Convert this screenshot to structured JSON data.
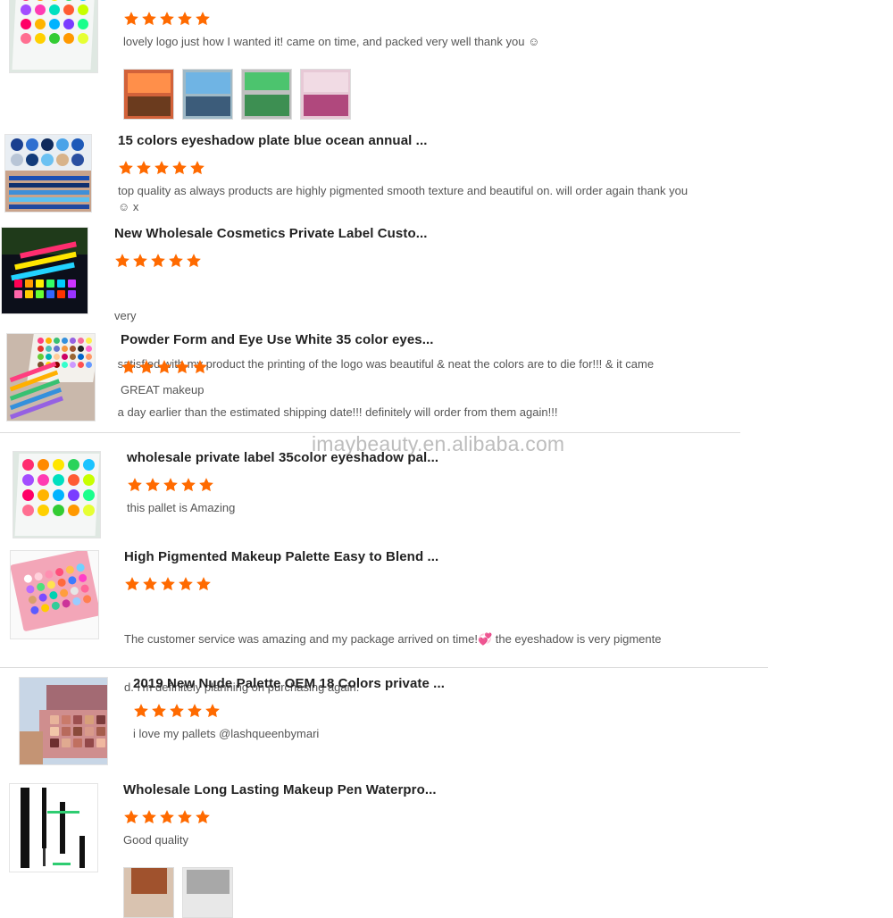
{
  "colors": {
    "star": "#ff6a00",
    "divider": "#dcdcdc"
  },
  "reviews": [
    {
      "title": "",
      "rating": 5,
      "text": "lovely logo just how I wanted it! came on time, and packed very well thank you ☺"
    },
    {
      "title": "15 colors eyeshadow plate blue ocean annual ...",
      "rating": 5,
      "text": "top quality as always products are highly pigmented smooth texture and beautiful on. will order again thank you ☺ x"
    },
    {
      "title": "New Wholesale Cosmetics Private Label Custo...",
      "rating": 5,
      "text_lines": [
        "very",
        " satisfied with my product the printing of the logo was beautiful & neat the colors are to die for!!! & it came",
        " a day earlier than the estimated shipping date!!! definitely will order from them again!!!"
      ]
    },
    {
      "title": "Powder Form and Eye Use White 35 color eyes...",
      "rating": 5,
      "text": "GREAT makeup"
    },
    {
      "title": "wholesale private label 35color eyeshadow pal...",
      "rating": 5,
      "text": "this pallet is Amazing"
    },
    {
      "title": "High Pigmented Makeup Palette Easy to Blend ...",
      "rating": 5,
      "text_lines": [
        "The customer service was amazing and my package arrived on time!💞 the eyeshadow is very pigmente",
        "d. I'm definitely planning on purchasing again."
      ]
    },
    {
      "title": "2019 New Nude Palette OEM 18 Colors private ...",
      "rating": 5,
      "text": "i love my pallets @lashqueenbymari"
    },
    {
      "title": "Wholesale Long Lasting Makeup Pen Waterpro...",
      "rating": 5,
      "text": "Good quality"
    }
  ],
  "watermark": "imaybeauty.en.alibaba.com",
  "thumb_icons": [
    "neon-palette-thumb",
    "blue-palette-thumb",
    "rainbow-palette-thumb",
    "white-palette-thumb",
    "neon-palette-thumb-2",
    "pink-palette-thumb",
    "nude-palette-thumb",
    "eyeliner-pen-thumb"
  ]
}
